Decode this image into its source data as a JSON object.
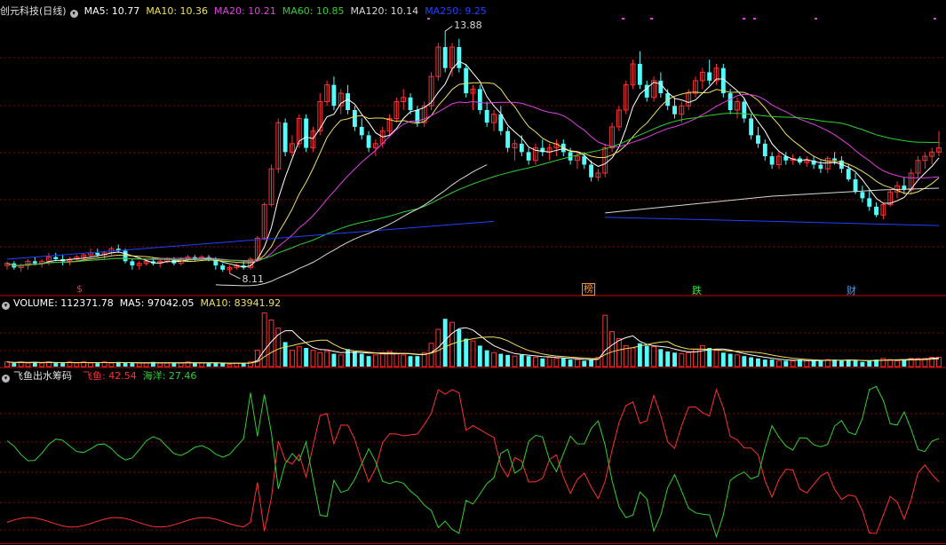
{
  "price_panel": {
    "title": "创元科技(日线)",
    "ma_labels": [
      {
        "text": "MA5: 10.77",
        "color": "#ffffff"
      },
      {
        "text": "MA10: 10.36",
        "color": "#f0e060"
      },
      {
        "text": "MA20: 10.21",
        "color": "#e040e0"
      },
      {
        "text": "MA60: 10.85",
        "color": "#30d030"
      },
      {
        "text": "MA120: 10.14",
        "color": "#d8d8d8"
      },
      {
        "text": "MA250: 9.25",
        "color": "#2040ff"
      }
    ],
    "high_label": "13.88",
    "low_label": "8.11",
    "tags": [
      {
        "text": "$",
        "color": "#ff3030"
      },
      {
        "text": "榜",
        "color": "#ff9030"
      },
      {
        "text": "跌",
        "color": "#40e040"
      },
      {
        "text": "财",
        "color": "#40a0ff"
      }
    ]
  },
  "volume_panel": {
    "labels": [
      {
        "text": "VOLUME: 112371.78",
        "color": "#ffffff"
      },
      {
        "text": "MA5: 97042.05",
        "color": "#ffffff"
      },
      {
        "text": "MA10: 83941.92",
        "color": "#f0e060"
      }
    ]
  },
  "indicator_panel": {
    "title": "飞鱼出水筹码",
    "labels": [
      {
        "text": "飞鱼: 42.54",
        "color": "#ff3030"
      },
      {
        "text": "海洋: 27.46",
        "color": "#30d030"
      }
    ]
  },
  "colors": {
    "up": "#ff3232",
    "down": "#54fcfc",
    "grid": "#8b0000",
    "divider": "#c00000"
  },
  "chart_data": {
    "type": "candlestick",
    "series_note": "daily candles, values in price units (CNY)",
    "candles": [
      [
        8.3,
        8.4,
        8.2,
        8.35
      ],
      [
        8.35,
        8.4,
        8.2,
        8.25
      ],
      [
        8.25,
        8.35,
        8.15,
        8.3
      ],
      [
        8.3,
        8.45,
        8.2,
        8.4
      ],
      [
        8.4,
        8.5,
        8.3,
        8.35
      ],
      [
        8.35,
        8.45,
        8.25,
        8.4
      ],
      [
        8.4,
        8.6,
        8.3,
        8.5
      ],
      [
        8.5,
        8.6,
        8.4,
        8.45
      ],
      [
        8.45,
        8.55,
        8.3,
        8.4
      ],
      [
        8.4,
        8.5,
        8.3,
        8.45
      ],
      [
        8.45,
        8.55,
        8.4,
        8.5
      ],
      [
        8.5,
        8.6,
        8.45,
        8.55
      ],
      [
        8.55,
        8.7,
        8.5,
        8.6
      ],
      [
        8.6,
        8.7,
        8.5,
        8.55
      ],
      [
        8.55,
        8.65,
        8.45,
        8.6
      ],
      [
        8.6,
        8.75,
        8.55,
        8.7
      ],
      [
        8.7,
        8.8,
        8.6,
        8.65
      ],
      [
        8.65,
        8.7,
        8.35,
        8.4
      ],
      [
        8.4,
        8.45,
        8.2,
        8.3
      ],
      [
        8.3,
        8.4,
        8.2,
        8.35
      ],
      [
        8.35,
        8.45,
        8.3,
        8.4
      ],
      [
        8.4,
        8.5,
        8.3,
        8.35
      ],
      [
        8.35,
        8.45,
        8.25,
        8.4
      ],
      [
        8.4,
        8.5,
        8.35,
        8.45
      ],
      [
        8.45,
        8.5,
        8.3,
        8.35
      ],
      [
        8.35,
        8.5,
        8.3,
        8.45
      ],
      [
        8.45,
        8.55,
        8.4,
        8.5
      ],
      [
        8.5,
        8.55,
        8.4,
        8.45
      ],
      [
        8.45,
        8.55,
        8.4,
        8.5
      ],
      [
        8.5,
        8.55,
        8.4,
        8.45
      ],
      [
        8.45,
        8.5,
        8.2,
        8.3
      ],
      [
        8.3,
        8.35,
        8.15,
        8.2
      ],
      [
        8.2,
        8.3,
        8.11,
        8.25
      ],
      [
        8.25,
        8.35,
        8.2,
        8.3
      ],
      [
        8.3,
        8.4,
        8.2,
        8.25
      ],
      [
        8.25,
        8.5,
        8.2,
        8.45
      ],
      [
        8.45,
        9.0,
        8.4,
        8.95
      ],
      [
        8.95,
        9.8,
        8.9,
        9.75
      ],
      [
        9.75,
        10.7,
        9.7,
        10.6
      ],
      [
        10.6,
        11.8,
        10.5,
        11.7
      ],
      [
        11.7,
        11.8,
        10.9,
        11.0
      ],
      [
        11.0,
        11.4,
        10.9,
        11.2
      ],
      [
        11.2,
        11.9,
        11.1,
        11.8
      ],
      [
        11.8,
        11.9,
        11.0,
        11.1
      ],
      [
        11.1,
        11.6,
        11.0,
        11.5
      ],
      [
        11.5,
        12.4,
        11.4,
        12.2
      ],
      [
        12.2,
        12.7,
        12.1,
        12.6
      ],
      [
        12.6,
        12.8,
        12.0,
        12.1
      ],
      [
        12.1,
        12.5,
        11.9,
        12.4
      ],
      [
        12.4,
        12.6,
        11.9,
        12.0
      ],
      [
        12.0,
        12.1,
        11.5,
        11.6
      ],
      [
        11.6,
        11.8,
        11.3,
        11.4
      ],
      [
        11.4,
        11.5,
        11.0,
        11.1
      ],
      [
        11.1,
        11.3,
        10.9,
        11.2
      ],
      [
        11.2,
        11.6,
        11.1,
        11.5
      ],
      [
        11.5,
        11.9,
        11.4,
        11.8
      ],
      [
        11.8,
        12.3,
        11.7,
        12.2
      ],
      [
        12.2,
        12.5,
        12.0,
        12.3
      ],
      [
        12.3,
        12.4,
        11.9,
        12.0
      ],
      [
        12.0,
        12.1,
        11.6,
        11.7
      ],
      [
        11.7,
        12.2,
        11.6,
        12.1
      ],
      [
        12.1,
        12.9,
        12.0,
        12.8
      ],
      [
        12.8,
        13.6,
        12.7,
        13.5
      ],
      [
        13.5,
        13.88,
        12.9,
        13.0
      ],
      [
        13.0,
        13.6,
        12.8,
        13.5
      ],
      [
        13.5,
        13.7,
        12.9,
        13.0
      ],
      [
        13.0,
        13.1,
        12.3,
        12.4
      ],
      [
        12.4,
        12.6,
        12.0,
        12.5
      ],
      [
        12.5,
        12.6,
        11.9,
        12.0
      ],
      [
        12.0,
        12.2,
        11.6,
        11.7
      ],
      [
        11.7,
        12.0,
        11.5,
        11.9
      ],
      [
        11.9,
        12.1,
        11.4,
        11.5
      ],
      [
        11.5,
        11.6,
        11.0,
        11.1
      ],
      [
        11.1,
        11.3,
        10.8,
        11.2
      ],
      [
        11.2,
        11.4,
        10.9,
        11.0
      ],
      [
        11.0,
        11.1,
        10.7,
        10.8
      ],
      [
        10.8,
        11.2,
        10.7,
        11.1
      ],
      [
        11.1,
        11.3,
        10.9,
        11.0
      ],
      [
        11.0,
        11.2,
        10.8,
        11.1
      ],
      [
        11.1,
        11.3,
        10.9,
        11.2
      ],
      [
        11.2,
        11.3,
        10.9,
        11.0
      ],
      [
        11.0,
        11.1,
        10.7,
        10.8
      ],
      [
        10.8,
        11.0,
        10.6,
        10.9
      ],
      [
        10.9,
        11.0,
        10.6,
        10.7
      ],
      [
        10.7,
        10.8,
        10.3,
        10.4
      ],
      [
        10.4,
        10.6,
        10.3,
        10.5
      ],
      [
        10.5,
        11.2,
        10.4,
        11.1
      ],
      [
        11.1,
        11.7,
        11.0,
        11.6
      ],
      [
        11.6,
        12.1,
        11.5,
        12.0
      ],
      [
        12.0,
        12.7,
        11.9,
        12.6
      ],
      [
        12.6,
        13.2,
        12.5,
        13.1
      ],
      [
        13.1,
        13.4,
        12.5,
        12.6
      ],
      [
        12.6,
        12.7,
        12.2,
        12.3
      ],
      [
        12.3,
        12.8,
        12.2,
        12.7
      ],
      [
        12.7,
        12.9,
        12.3,
        12.4
      ],
      [
        12.4,
        12.5,
        12.0,
        12.1
      ],
      [
        12.1,
        12.3,
        11.8,
        11.9
      ],
      [
        11.9,
        12.2,
        11.7,
        12.1
      ],
      [
        12.1,
        12.5,
        12.0,
        12.4
      ],
      [
        12.4,
        12.8,
        12.3,
        12.7
      ],
      [
        12.7,
        13.0,
        12.5,
        12.9
      ],
      [
        12.9,
        13.2,
        12.6,
        12.7
      ],
      [
        12.7,
        13.1,
        12.6,
        13.0
      ],
      [
        13.0,
        13.1,
        12.3,
        12.4
      ],
      [
        12.4,
        12.5,
        11.9,
        12.0
      ],
      [
        12.0,
        12.3,
        11.8,
        12.2
      ],
      [
        12.2,
        12.3,
        11.7,
        11.8
      ],
      [
        11.8,
        11.9,
        11.3,
        11.4
      ],
      [
        11.4,
        11.6,
        11.1,
        11.2
      ],
      [
        11.2,
        11.3,
        10.8,
        10.9
      ],
      [
        10.9,
        11.0,
        10.6,
        10.7
      ],
      [
        10.7,
        11.0,
        10.6,
        10.9
      ],
      [
        10.9,
        11.0,
        10.7,
        10.8
      ],
      [
        10.8,
        10.95,
        10.7,
        10.85
      ],
      [
        10.85,
        10.9,
        10.7,
        10.75
      ],
      [
        10.75,
        10.9,
        10.65,
        10.8
      ],
      [
        10.8,
        10.9,
        10.6,
        10.7
      ],
      [
        10.7,
        10.8,
        10.5,
        10.6
      ],
      [
        10.6,
        10.9,
        10.5,
        10.85
      ],
      [
        10.85,
        11.0,
        10.7,
        10.8
      ],
      [
        10.8,
        10.9,
        10.5,
        10.6
      ],
      [
        10.6,
        10.7,
        10.3,
        10.35
      ],
      [
        10.35,
        10.5,
        10.0,
        10.05
      ],
      [
        10.05,
        10.2,
        9.8,
        9.9
      ],
      [
        9.9,
        10.1,
        9.6,
        9.7
      ],
      [
        9.7,
        9.8,
        9.45,
        9.5
      ],
      [
        9.5,
        9.8,
        9.4,
        9.75
      ],
      [
        9.75,
        10.1,
        9.7,
        10.05
      ],
      [
        10.05,
        10.3,
        9.9,
        10.2
      ],
      [
        10.2,
        10.4,
        10.0,
        10.1
      ],
      [
        10.1,
        10.6,
        10.0,
        10.5
      ],
      [
        10.5,
        10.9,
        10.4,
        10.8
      ],
      [
        10.8,
        11.0,
        10.6,
        10.9
      ],
      [
        10.9,
        11.1,
        10.7,
        11.0
      ],
      [
        11.0,
        11.5,
        10.9,
        11.1
      ]
    ],
    "volume": [
      4,
      3,
      4,
      3,
      4,
      3,
      4,
      3,
      3,
      4,
      3,
      4,
      3,
      3,
      4,
      3,
      4,
      3,
      3,
      3,
      3,
      4,
      3,
      3,
      3,
      3,
      4,
      3,
      3,
      3,
      3,
      3,
      2,
      3,
      3,
      4,
      14,
      46,
      40,
      33,
      21,
      14,
      17,
      16,
      14,
      12,
      13,
      11,
      10,
      15,
      13,
      11,
      9,
      10,
      12,
      13,
      11,
      10,
      9,
      9,
      12,
      20,
      32,
      41,
      38,
      32,
      24,
      22,
      18,
      14,
      12,
      11,
      10,
      9,
      10,
      9,
      8,
      7,
      8,
      7,
      7,
      6,
      6,
      5,
      6,
      8,
      44,
      30,
      24,
      18,
      16,
      20,
      18,
      17,
      15,
      13,
      12,
      11,
      12,
      15,
      18,
      16,
      14,
      12,
      11,
      10,
      9,
      8,
      7,
      6,
      6,
      5,
      5,
      5,
      6,
      5,
      5,
      5,
      6,
      6,
      5,
      6,
      5,
      4,
      5,
      6,
      7,
      6,
      5,
      6,
      7,
      7,
      7,
      8,
      8,
      6
    ],
    "indicator": {
      "feiyu_last": 42.54,
      "haiyang_last": 27.46
    }
  }
}
